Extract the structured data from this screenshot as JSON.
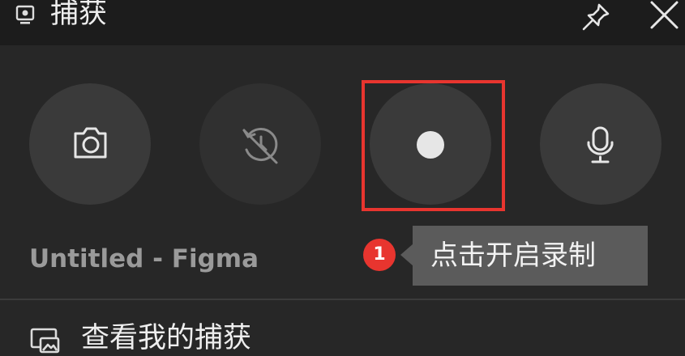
{
  "header": {
    "title": "捕获",
    "icons": {
      "capture": "capture-widget-icon",
      "pin": "pin-icon",
      "close": "close-icon"
    }
  },
  "capture_buttons": [
    {
      "name": "screenshot",
      "icon": "camera-icon",
      "enabled": true
    },
    {
      "name": "record-last-30s",
      "icon": "record-last-30s-icon",
      "enabled": false
    },
    {
      "name": "start-recording",
      "icon": "record-dot-icon",
      "enabled": true,
      "highlighted": true
    },
    {
      "name": "microphone",
      "icon": "microphone-icon",
      "enabled": true
    }
  ],
  "app_name": "Untitled - Figma",
  "annotation": {
    "step_number": "1",
    "tooltip_text": "点击开启录制",
    "highlight_color": "#e8352f"
  },
  "footer": {
    "gallery_label": "查看我的捕获",
    "gallery_icon": "gallery-icon"
  },
  "colors": {
    "panel_bg": "#272727",
    "header_bg": "#1c1c1c",
    "button_bg": "#3a3a3a",
    "tooltip_bg": "#5b5b5b",
    "accent_red": "#e8352f"
  }
}
